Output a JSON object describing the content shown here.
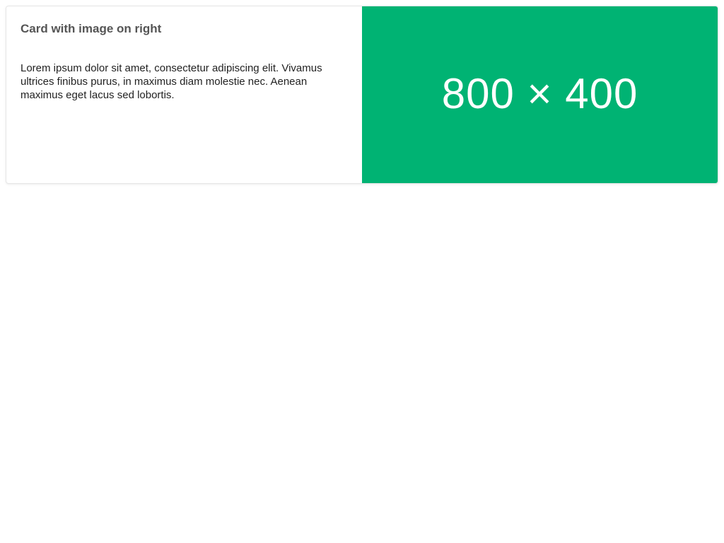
{
  "card": {
    "title": "Card with image on right",
    "text": "Lorem ipsum dolor sit amet, consectetur adipiscing elit. Vivamus ultrices finibus purus, in maximus diam molestie nec. Aenean maximus eget lacus sed lobortis.",
    "image_label": "800 × 400",
    "image_color": "#00b373"
  }
}
